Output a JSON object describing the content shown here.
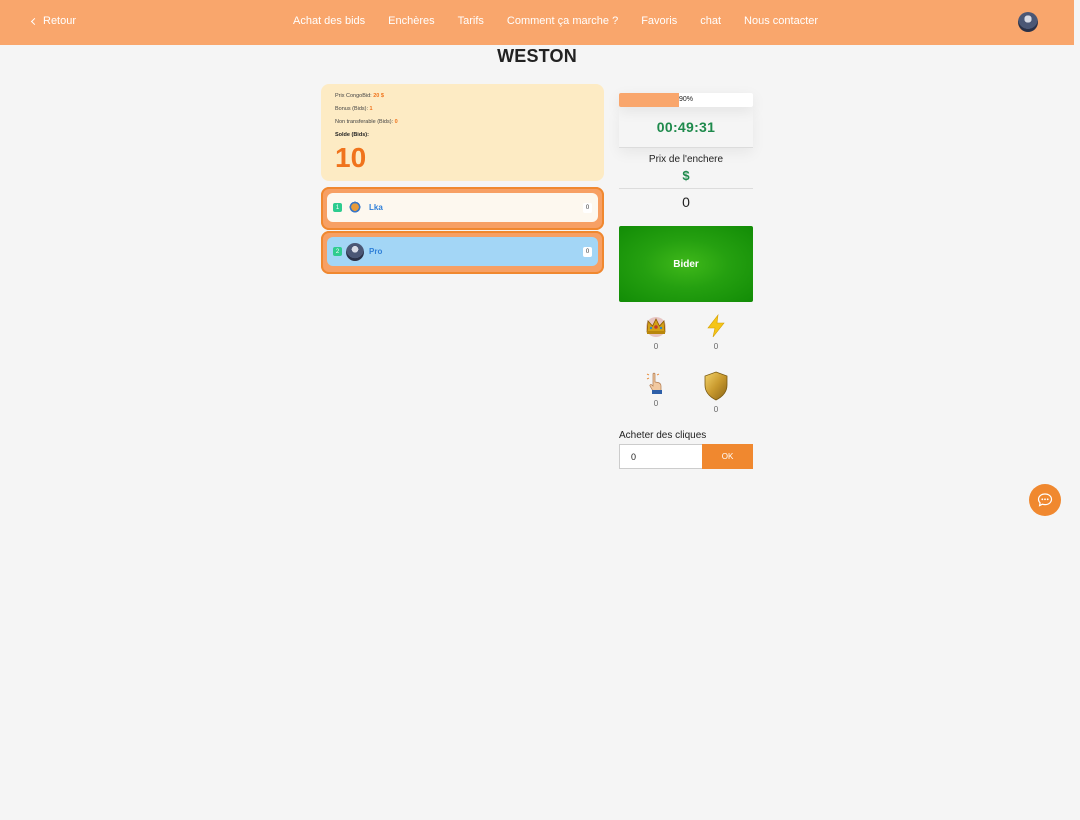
{
  "header": {
    "back_label": "Retour",
    "nav": [
      "Achat des bids",
      "Enchères",
      "Tarifs",
      "Comment ça marche ?",
      "Favoris",
      "chat",
      "Nous contacter"
    ]
  },
  "page_title": "WESTON",
  "info": {
    "prix_label": "Prix CongoBid:",
    "prix_value": "20 $",
    "bonus_label": "Bonus (Bids):",
    "bonus_value": "1",
    "nontransf_label": "Non transferable (Bids):",
    "nontransf_value": "0",
    "solde_label": "Solde (Bids):",
    "solde_value": "10"
  },
  "bidders": [
    {
      "rank": "1",
      "name": "Lka",
      "count": "0"
    },
    {
      "rank": "2",
      "name": "Pro",
      "count": "0"
    }
  ],
  "auction": {
    "progress_label": "90%",
    "progress_value": 0.45,
    "timer": "00:49:31",
    "price_label": "Prix de l'enchere",
    "currency": "$",
    "price_value": "0",
    "bid_button": "Bider"
  },
  "boosts": [
    {
      "icon": "crown-icon",
      "count": "0"
    },
    {
      "icon": "lightning-icon",
      "count": "0"
    },
    {
      "icon": "pointer-hand-icon",
      "count": "0"
    },
    {
      "icon": "shield-icon",
      "count": "0"
    }
  ],
  "buy_clicks": {
    "label": "Acheter des cliques",
    "value": "0",
    "ok_label": "OK"
  },
  "colors": {
    "header_bg": "#f9a66c",
    "accent": "#f0882f",
    "timer_green": "#1e8a4c",
    "bid_green": "#25a010"
  }
}
